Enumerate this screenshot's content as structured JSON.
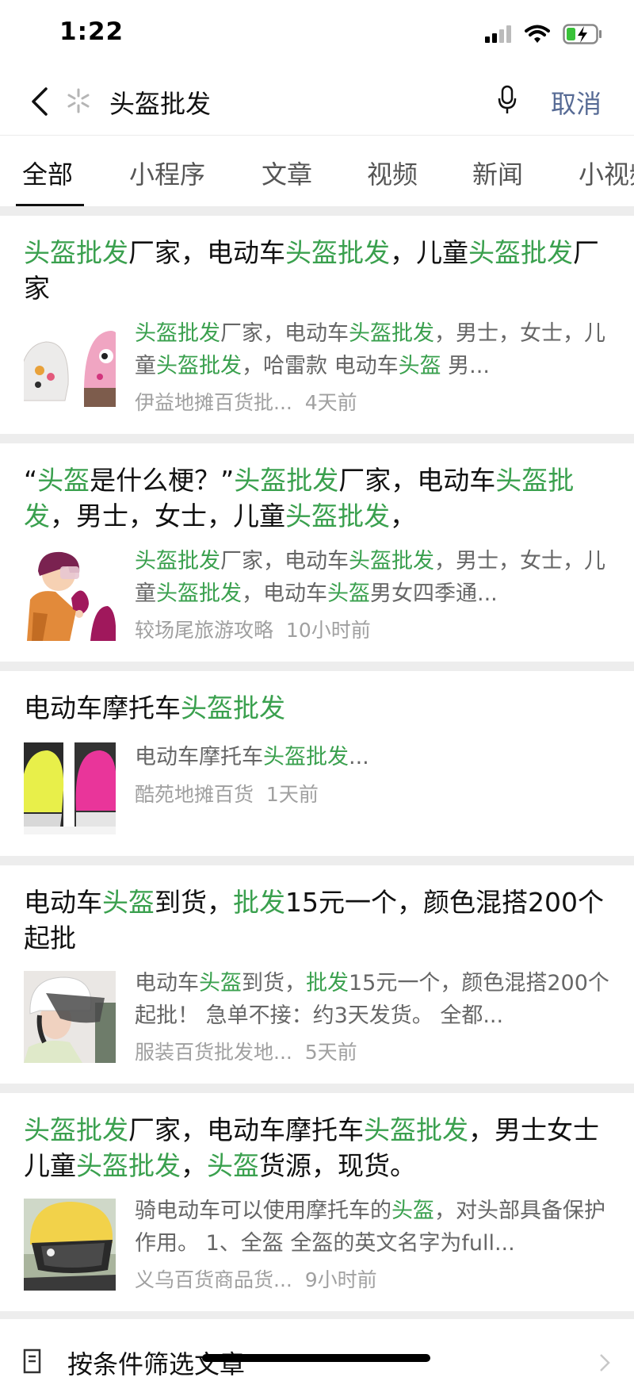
{
  "status": {
    "time": "1:22"
  },
  "search": {
    "query": "头盔批发",
    "cancel": "取消"
  },
  "tabs": [
    "全部",
    "小程序",
    "文章",
    "视频",
    "新闻",
    "小视频"
  ],
  "results": [
    {
      "title": [
        [
          "头盔批发",
          1
        ],
        [
          "厂家，电动车",
          0
        ],
        [
          "头盔批发",
          1
        ],
        [
          "，儿童",
          0
        ],
        [
          "头盔批发",
          1
        ],
        [
          "厂家",
          0
        ]
      ],
      "snippet": [
        [
          "头盔批发",
          1
        ],
        [
          "厂家，电动车",
          0
        ],
        [
          "头盔批发",
          1
        ],
        [
          "，男士，女士，儿童",
          0
        ],
        [
          "头盔批发",
          1
        ],
        [
          "，哈雷款 电动车",
          0
        ],
        [
          "头盔",
          1
        ],
        [
          " 男...",
          0
        ]
      ],
      "source": "伊益地摊百货批...",
      "time": "4天前"
    },
    {
      "title": [
        [
          "“",
          0
        ],
        [
          "头盔",
          1
        ],
        [
          "是什么梗？”",
          0
        ],
        [
          "头盔批发",
          1
        ],
        [
          "厂家，电动车",
          0
        ],
        [
          "头盔批发",
          1
        ],
        [
          "，男士，女士，儿童",
          0
        ],
        [
          "头盔批发",
          1
        ],
        [
          "，",
          0
        ]
      ],
      "snippet": [
        [
          "头盔批发",
          1
        ],
        [
          "厂家，电动车",
          0
        ],
        [
          "头盔批发",
          1
        ],
        [
          "，男士，女士，儿童",
          0
        ],
        [
          "头盔批发",
          1
        ],
        [
          "，电动车",
          0
        ],
        [
          "头盔",
          1
        ],
        [
          "男女四季通...",
          0
        ]
      ],
      "source": "较场尾旅游攻略",
      "time": "10小时前"
    },
    {
      "title": [
        [
          "电动车摩托车",
          0
        ],
        [
          "头盔批发",
          1
        ]
      ],
      "snippet": [
        [
          "电动车摩托车",
          0
        ],
        [
          "头盔批发",
          1
        ],
        [
          "...",
          0
        ]
      ],
      "source": "酷苑地摊百货",
      "time": "1天前"
    },
    {
      "title": [
        [
          "电动车",
          0
        ],
        [
          "头盔",
          1
        ],
        [
          "到货，",
          0
        ],
        [
          "批发",
          1
        ],
        [
          "15元一个，颜色混搭200个起批",
          0
        ]
      ],
      "snippet": [
        [
          "电动车",
          0
        ],
        [
          "头盔",
          1
        ],
        [
          "到货，",
          0
        ],
        [
          "批发",
          1
        ],
        [
          "15元一个，颜色混搭200个起批！ 急单不接：约3天发货。 全都...",
          0
        ]
      ],
      "source": "服装百货批发地...",
      "time": "5天前"
    },
    {
      "title": [
        [
          "头盔批发",
          1
        ],
        [
          "厂家，电动车摩托车",
          0
        ],
        [
          "头盔批发",
          1
        ],
        [
          "，男士女士儿童",
          0
        ],
        [
          "头盔批发",
          1
        ],
        [
          "，",
          0
        ],
        [
          "头盔",
          1
        ],
        [
          "货源，现货。",
          0
        ]
      ],
      "snippet": [
        [
          "骑电动车可以使用摩托车的",
          0
        ],
        [
          "头盔",
          1
        ],
        [
          "，对头部具备保护作用。 1、全盔 全盔的英文名字为full...",
          0
        ]
      ],
      "source": "义乌百货商品货...",
      "time": "9小时前"
    }
  ],
  "filter": {
    "label": "按条件筛选文章"
  },
  "colors": {
    "highlight": "#3aa04e",
    "link": "#576b95",
    "separator": "#ededed"
  }
}
